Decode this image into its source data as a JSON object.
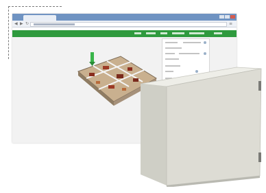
{
  "icons": {
    "back": "back-arrow-icon",
    "forward": "forward-arrow-icon",
    "reload": "reload-icon",
    "menu": "menu-icon",
    "monitor_figure": "pin-marker-icon",
    "cabinet": "enclosure-box-icon"
  },
  "colors": {
    "nav_bar": "#2f9a3e",
    "browser_chrome": "#6f93c2",
    "cabinet": "#dcdcd4",
    "marker": "#39b54a"
  }
}
